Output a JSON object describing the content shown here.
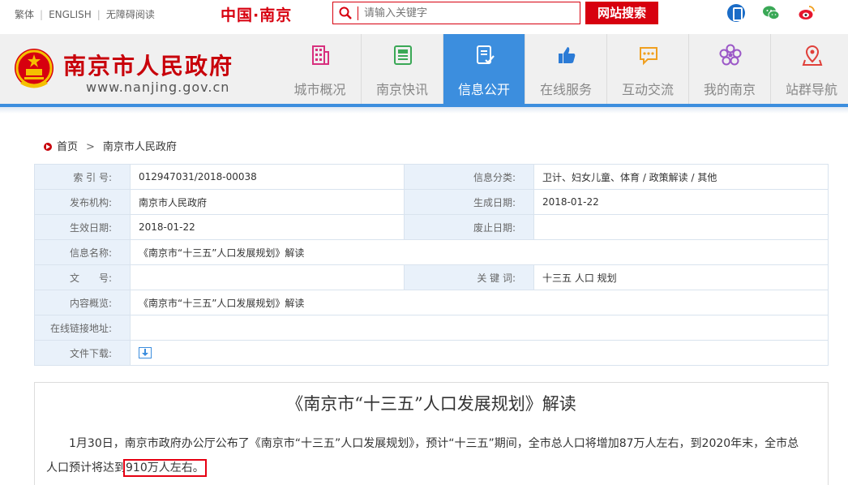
{
  "topbar": {
    "links": [
      "繁体",
      "ENGLISH",
      "无障碍阅读"
    ],
    "brand": "中国·南京",
    "search_placeholder": "请输入关键字",
    "search_button": "网站搜索",
    "social_icons": [
      "mobile-icon",
      "wechat-icon",
      "weibo-icon"
    ]
  },
  "header": {
    "site_name": "南京市人民政府",
    "site_url": "www.nanjing.gov.cn",
    "nav": [
      {
        "label": "城市概况",
        "icon": "building-icon",
        "color": "#d8307e"
      },
      {
        "label": "南京快讯",
        "icon": "newspaper-icon",
        "color": "#3aa856"
      },
      {
        "label": "信息公开",
        "icon": "document-check-icon",
        "color": "#ffffff",
        "active": true
      },
      {
        "label": "在线服务",
        "icon": "thumbs-up-icon",
        "color": "#2b7bd6"
      },
      {
        "label": "互动交流",
        "icon": "chat-icon",
        "color": "#f0a020"
      },
      {
        "label": "我的南京",
        "icon": "flower-icon",
        "color": "#9b57c7"
      },
      {
        "label": "站群导航",
        "icon": "location-pin-icon",
        "color": "#e0403a"
      }
    ]
  },
  "breadcrumb": {
    "home": "首页",
    "current": "南京市人民政府"
  },
  "info": {
    "index_label": "索 引 号:",
    "index_value": "012947031/2018-00038",
    "category_label": "信息分类:",
    "category_value": "卫计、妇女儿童、体育 / 政策解读 / 其他",
    "publisher_label": "发布机构:",
    "publisher_value": "南京市人民政府",
    "created_label": "生成日期:",
    "created_value": "2018-01-22",
    "effective_label": "生效日期:",
    "effective_value": "2018-01-22",
    "abolished_label": "废止日期:",
    "abolished_value": "",
    "name_label": "信息名称:",
    "name_value": "《南京市“十三五”人口发展规划》解读",
    "docno_label": "文　　号:",
    "docno_value": "",
    "keywords_label": "关 键 词:",
    "keywords_value": "十三五 人口 规划",
    "summary_label": "内容概览:",
    "summary_value": "《南京市“十三五”人口发展规划》解读",
    "link_label": "在线链接地址:",
    "link_value": "",
    "download_label": "文件下载:"
  },
  "article": {
    "title": "《南京市“十三五”人口发展规划》解读",
    "body_before": "1月30日，南京市政府办公厅公布了《南京市“十三五”人口发展规划》，预计“十三五”期间，全市总人口将增加87万人左右，到2020年末，全市总人口预计将达到",
    "body_highlight": "910万人左右。"
  },
  "colors": {
    "brand_red": "#d7000f",
    "nav_active": "#3c8ede",
    "label_bg": "#e9f1fa"
  }
}
